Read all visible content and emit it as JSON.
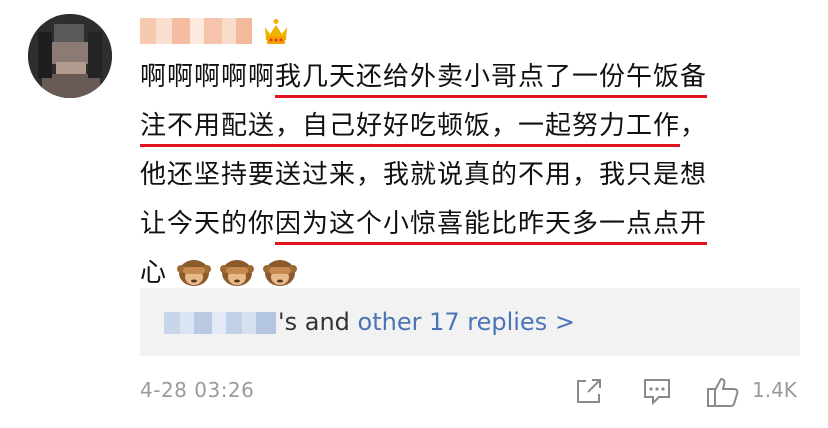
{
  "comment": {
    "lines": [
      [
        "啊啊啊啊啊",
        "我几天还给外卖小哥点了一份午饭备",
        ""
      ],
      [
        "注不用配送，自己好好吃顿饭，一起努力工作",
        "",
        "，"
      ],
      [
        "他还坚持要送过来，我就说真的不用，我只是想",
        "",
        ""
      ],
      [
        "让今天的你",
        "因为这个小惊喜能比昨天多一点点开",
        ""
      ],
      [
        "",
        "心",
        ""
      ]
    ],
    "emojis": [
      "see-no-evil-monkey",
      "see-no-evil-monkey",
      "see-no-evil-monkey"
    ]
  },
  "replies": {
    "suffix": "'s and ",
    "link": "other 17 replies >"
  },
  "footer": {
    "date": "4-28 03:26",
    "likes": "1.4K"
  },
  "colors": {
    "highlight_underline": "#e0141e",
    "link": "#4a74b8",
    "meta_gray": "#9a9a9a",
    "reply_bg": "#f2f2f2",
    "crown": "#f0b400"
  }
}
